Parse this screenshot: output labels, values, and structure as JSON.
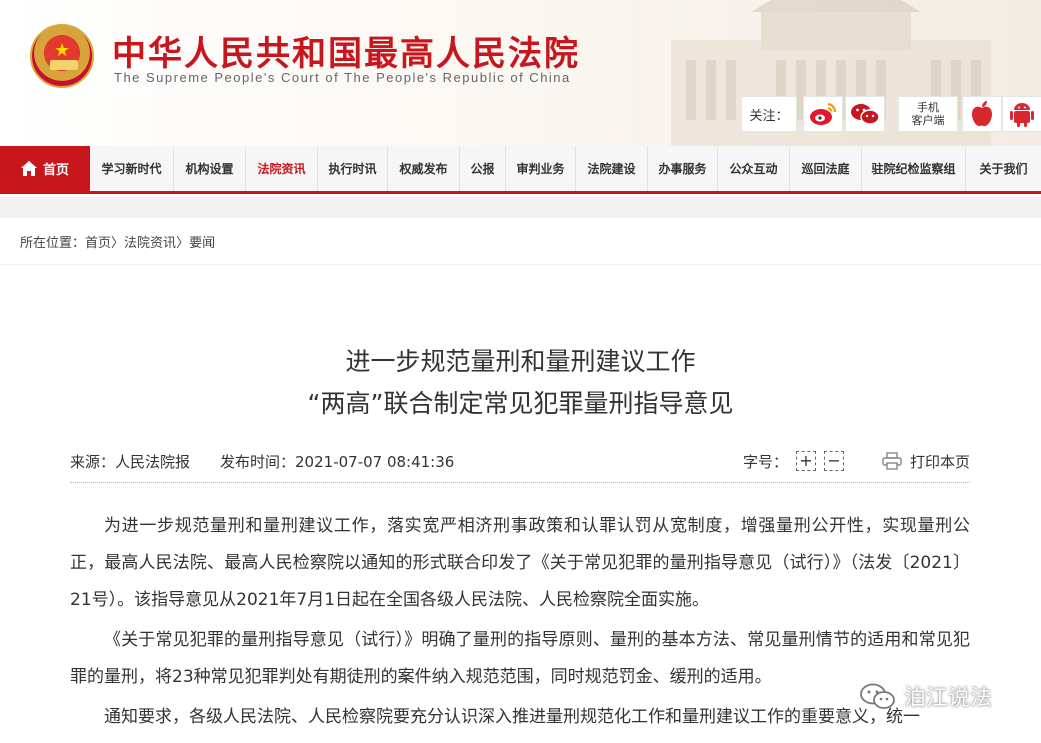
{
  "header": {
    "site_title": "中华人民共和国最高人民法院",
    "site_subtitle": "The Supreme People's Court of The People's Republic of China",
    "follow_label": "关注：",
    "client_line1": "手机",
    "client_line2": "客户端"
  },
  "nav": {
    "home": "首页",
    "items": [
      "学习新时代",
      "机构设置",
      "法院资讯",
      "执行时讯",
      "权威发布",
      "公报",
      "审判业务",
      "法院建设",
      "办事服务",
      "公众互动",
      "巡回法庭",
      "驻院纪检监察组",
      "关于我们"
    ]
  },
  "breadcrumb": {
    "prefix": "所在位置：",
    "home": "首页",
    "sep": " 〉 ",
    "level1": "法院资讯",
    "level2": "要闻"
  },
  "article": {
    "title_line1": "进一步规范量刑和量刑建议工作",
    "title_line2": "“两高”联合制定常见犯罪量刑指导意见",
    "source": "来源：人民法院报",
    "publish_time": "发布时间：2021-07-07 08:41:36",
    "font_size_label": "字号：",
    "plus": "+",
    "minus": "−",
    "print_label": "打印本页",
    "paragraphs": [
      "为进一步规范量刑和量刑建议工作，落实宽严相济刑事政策和认罪认罚从宽制度，增强量刑公开性，实现量刑公正，最高人民法院、最高人民检察院以通知的形式联合印发了《关于常见犯罪的量刑指导意见（试行）》（法发〔2021〕21号）。该指导意见从2021年7月1日起在全国各级人民法院、人民检察院全面实施。",
      "《关于常见犯罪的量刑指导意见（试行）》明确了量刑的指导原则、量刑的基本方法、常见量刑情节的适用和常见犯罪的量刑，将23种常见犯罪判处有期徒刑的案件纳入规范范围，同时规范罚金、缓刑的适用。",
      "通知要求，各级人民法院、人民检察院要充分认识深入推进量刑规范化工作和量刑建议工作的重要意义，统一"
    ]
  },
  "watermark": {
    "text": "泊江说法"
  },
  "colors": {
    "brand_red": "#c8161d",
    "nav_bg": "#f6f6f6"
  },
  "icons": {
    "home": "home-icon",
    "weibo": "weibo-icon",
    "wechat": "wechat-icon",
    "apple": "apple-icon",
    "android": "android-icon",
    "print": "printer-icon",
    "watermark": "wechat-watermark-icon"
  }
}
